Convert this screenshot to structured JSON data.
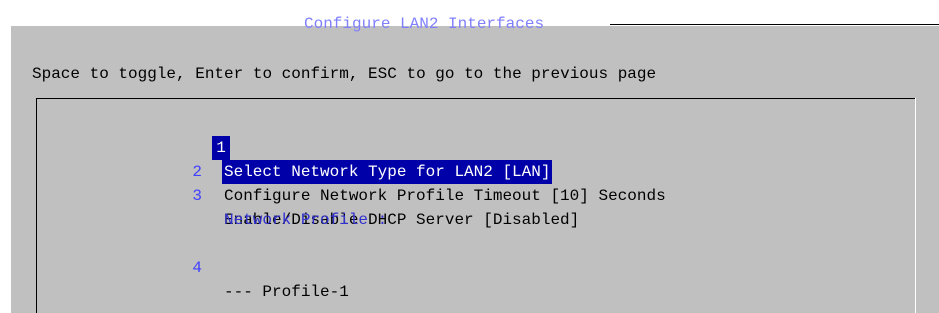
{
  "dialog": {
    "title": "Configure LAN2 Interfaces",
    "instructions": "Space to toggle, Enter to confirm, ESC to go to the previous page"
  },
  "menu": {
    "items": [
      {
        "number": "1",
        "label": "Select Network Type for LAN2 [LAN]",
        "selected": true
      },
      {
        "number": "2",
        "label": "Configure Network Profile Timeout [10] Seconds",
        "selected": false
      },
      {
        "number": "3",
        "label": "Enable/Disable DHCP Server [Disabled]",
        "selected": false
      }
    ],
    "section_label": "Network Profile :",
    "profiles": [
      {
        "number": "4",
        "label": "--- Profile-1"
      }
    ]
  },
  "colors": {
    "background": "#c0c0c0",
    "highlight": "#0000a8",
    "title": "#8080ff",
    "number": "#4040ff",
    "section_label": "#3030d0"
  }
}
